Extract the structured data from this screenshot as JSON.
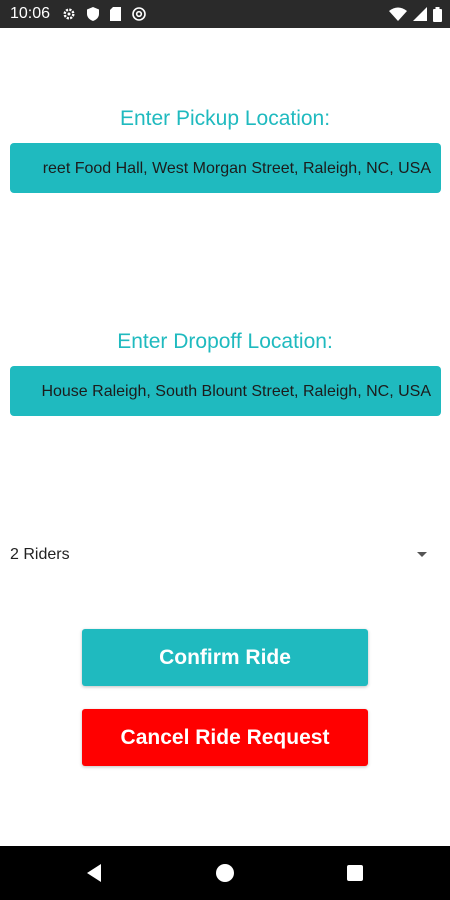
{
  "status_bar": {
    "time": "10:06",
    "left_icons": [
      "gear-icon",
      "shield-icon",
      "sim-card-icon",
      "at-sign-icon"
    ],
    "right_icons": [
      "wifi-icon",
      "signal-icon",
      "battery-icon"
    ]
  },
  "pickup": {
    "label": "Enter Pickup Location:",
    "value": "reet Food Hall, West Morgan Street, Raleigh, NC, USA"
  },
  "dropoff": {
    "label": "Enter Dropoff Location:",
    "value": "House Raleigh, South Blount Street, Raleigh, NC, USA"
  },
  "riders": {
    "selected": "2 Riders"
  },
  "buttons": {
    "confirm_label": "Confirm Ride",
    "cancel_label": "Cancel Ride Request"
  },
  "nav_bar": {
    "icons": [
      "back-triangle-icon",
      "home-circle-icon",
      "recents-square-icon"
    ]
  },
  "colors": {
    "accent": "#1fbabf",
    "cancel": "#ff0000",
    "status_bar": "#2a2a2a",
    "nav_bar": "#000000"
  }
}
